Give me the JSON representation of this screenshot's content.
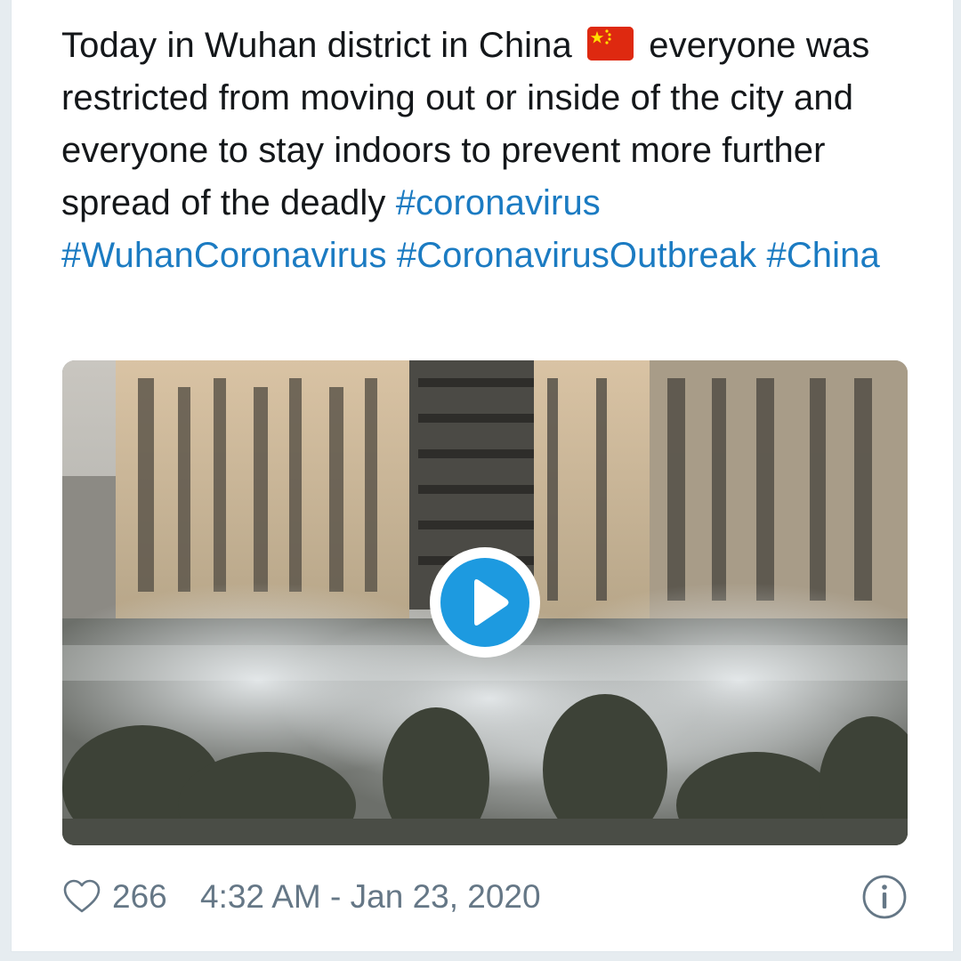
{
  "tweet": {
    "text_parts": {
      "before_flag": "Today in Wuhan district in China",
      "after_flag": " everyone was restricted from moving out or inside of the city and everyone to stay indoors to prevent more further spread of the deadly ",
      "hashtag_1": "#coronavirus",
      "hashtag_2": "#WuhanCoronavirus",
      "hashtag_3": "#CoronavirusOutbreak",
      "hashtag_4": "#China"
    },
    "flag_icon": "china-flag-emoji",
    "video": {
      "play_icon": "play-icon"
    },
    "footer": {
      "like_icon": "heart-outline-icon",
      "like_count": "266",
      "timestamp": "4:32 AM - Jan 23, 2020",
      "info_icon": "info-circle-icon"
    }
  },
  "colors": {
    "text": "#14171a",
    "hashtag": "#1b7bc2",
    "meta": "#657786",
    "play_button": "#1d9ae0",
    "card_bg": "#ffffff",
    "page_bg": "#e6ecf0"
  }
}
